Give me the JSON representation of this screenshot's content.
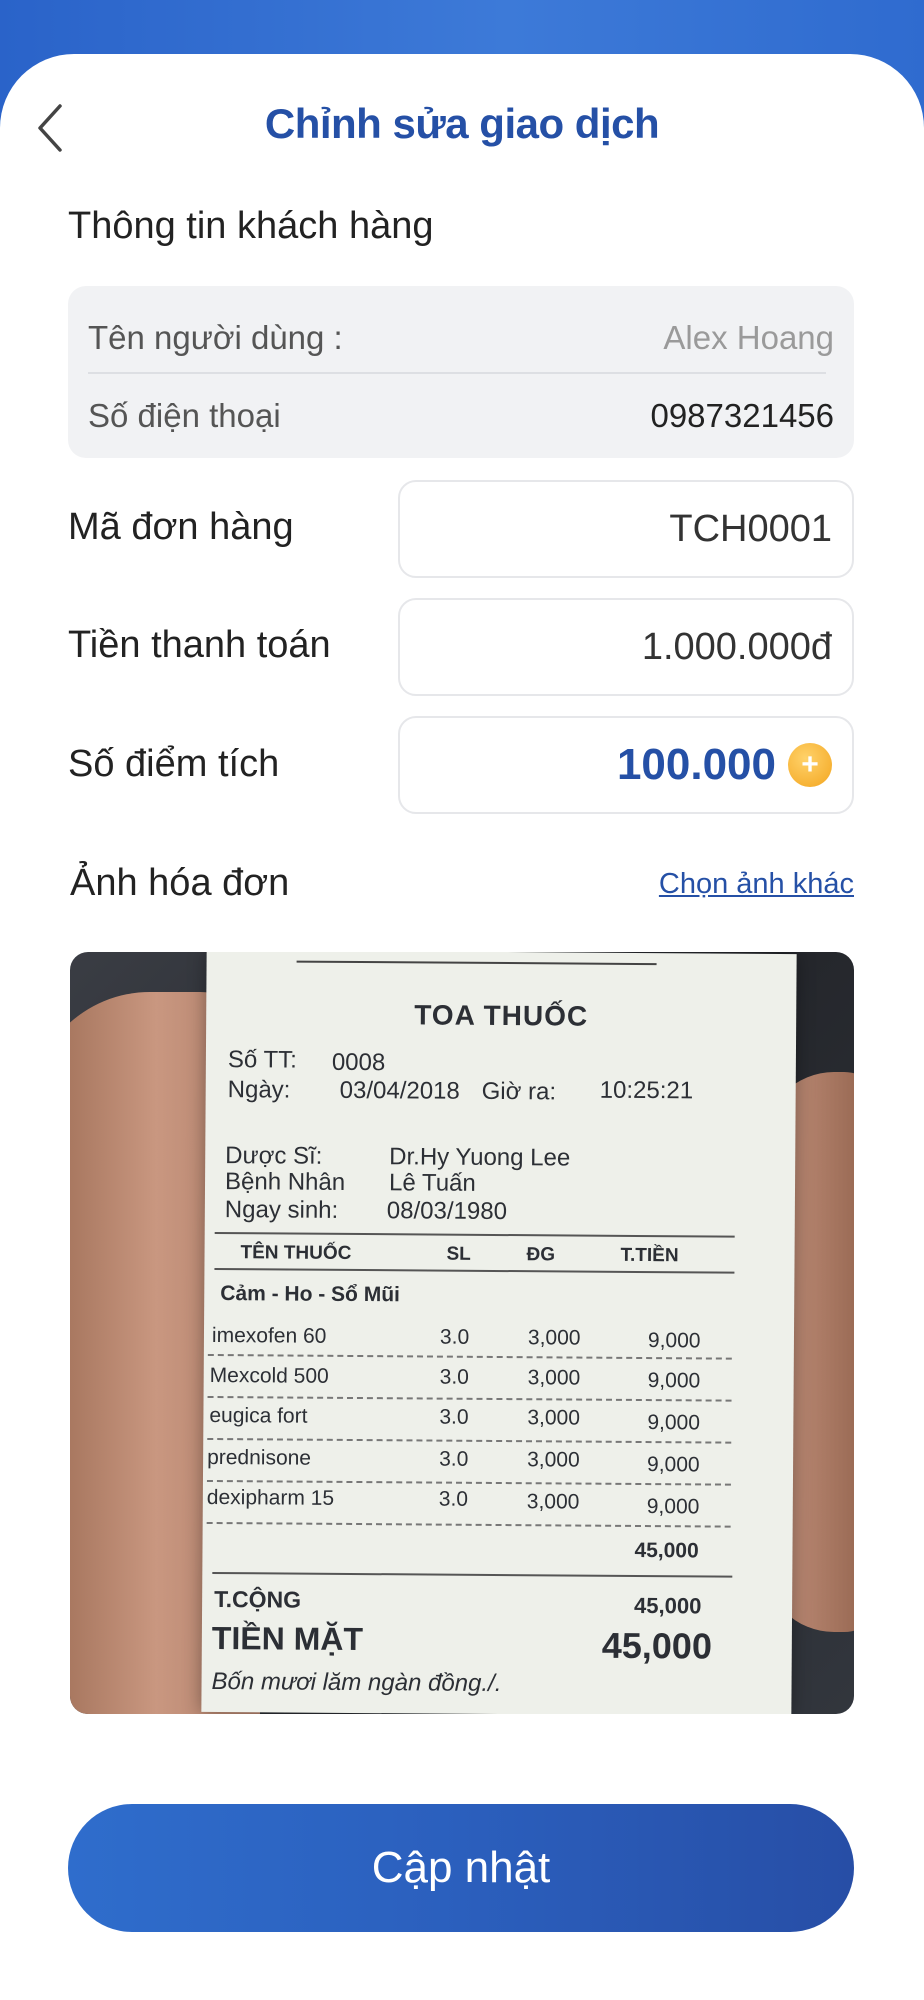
{
  "header": {
    "title": "Chỉnh sửa giao dịch"
  },
  "customer": {
    "section_title": "Thông tin khách hàng",
    "name_label": "Tên người dùng :",
    "name_value": "Alex Hoang",
    "phone_label": "Số điện thoại",
    "phone_value": "0987321456"
  },
  "order": {
    "code_label": "Mã đơn hàng",
    "code_value": "TCH0001",
    "amount_label": "Tiền thanh toán",
    "amount_value": "1.000.000đ",
    "points_label": "Số điểm tích",
    "points_value": "100.000",
    "coin_symbol": "+"
  },
  "invoice": {
    "title": "Ảnh hóa đơn",
    "change_link": "Chọn ảnh khác",
    "receipt": {
      "title": "TOA THUỐC",
      "so_tt_label": "Số TT:",
      "so_tt": "0008",
      "ngay_label": "Ngày:",
      "ngay": "03/04/2018",
      "gio_label": "Giờ ra:",
      "gio": "10:25:21",
      "duoc_si_label": "Dược Sĩ:",
      "duoc_si": "Dr.Hy Yuong Lee",
      "benh_nhan_label": "Bệnh Nhân",
      "benh_nhan": "Lê Tuấn",
      "ngay_sinh_label": "Ngay sinh:",
      "ngay_sinh": "08/03/1980",
      "columns": [
        "TÊN THUỐC",
        "SL",
        "ĐG",
        "T.TIỀN"
      ],
      "group": "Cảm - Ho - Sổ Mũi",
      "items": [
        {
          "name": "imexofen 60",
          "qty": "3.0",
          "price": "3,000",
          "total": "9,000"
        },
        {
          "name": "Mexcold 500",
          "qty": "3.0",
          "price": "3,000",
          "total": "9,000"
        },
        {
          "name": "eugica fort",
          "qty": "3.0",
          "price": "3,000",
          "total": "9,000"
        },
        {
          "name": "prednisone",
          "qty": "3.0",
          "price": "3,000",
          "total": "9,000"
        },
        {
          "name": "dexipharm 15",
          "qty": "3.0",
          "price": "3,000",
          "total": "9,000"
        }
      ],
      "subtotal": "45,000",
      "t_cong_label": "T.CỘNG",
      "t_cong": "45,000",
      "tien_mat_label": "TIỀN MẶT",
      "tien_mat": "45,000",
      "in_words": "Bốn mươi lăm ngàn đồng./."
    }
  },
  "footer": {
    "update_button": "Cập nhật"
  },
  "colors": {
    "primary": "#2550a6",
    "button_start": "#2f6dcc",
    "button_end": "#274ea6",
    "coin": "#f3a51f"
  },
  "icons": {
    "back": "chevron-left-icon",
    "coin": "coin-icon"
  }
}
